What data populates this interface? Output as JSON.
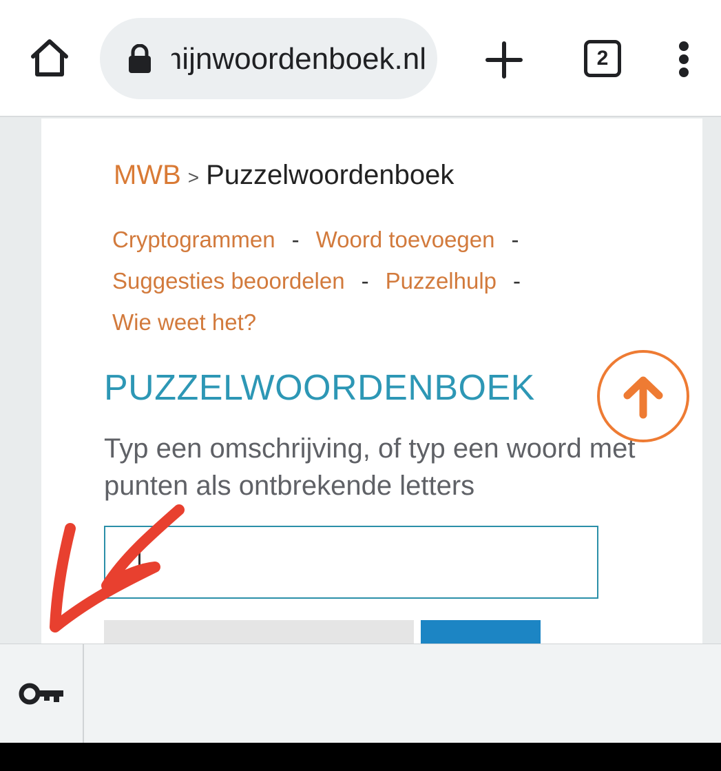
{
  "browser": {
    "url": "mijnwoordenboek.nl",
    "tab_count": "2",
    "icons": {
      "home": "home-icon",
      "lock": "lock-icon",
      "new_tab": "plus-icon",
      "tabs": "tab-switcher-icon",
      "menu": "more-vertical-icon"
    }
  },
  "breadcrumb": {
    "root": "MWB",
    "separator": ">",
    "current": "Puzzelwoordenboek"
  },
  "nav_links": {
    "cryptogrammen": "Cryptogrammen",
    "woord_toevoegen": "Woord toevoegen",
    "suggesties": "Suggesties beoordelen",
    "puzzelhulp": "Puzzelhulp",
    "wie_weet": "Wie weet het?",
    "dash": "-"
  },
  "main": {
    "heading": "PUZZELWOORDENBOEK",
    "instructions": "Typ een omschrijving, of typ een woord met punten als ontbrekende letters",
    "search_value": ""
  },
  "colors": {
    "link": "#d27a3c",
    "heading": "#2d97b5",
    "input_border": "#2a8fa8",
    "scroll_top": "#ee7b33",
    "annotation_arrow": "#e8402f"
  },
  "keyboard_bar": {
    "icon": "key-icon"
  }
}
